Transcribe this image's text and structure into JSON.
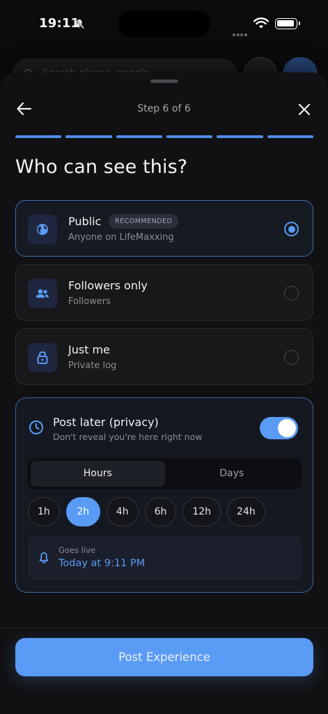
{
  "status_bar": {
    "time": "19:11"
  },
  "background_page": {
    "search_placeholder": "Search places, people…"
  },
  "header": {
    "step_label": "Step 6 of 6"
  },
  "progress": {
    "total_steps": 6,
    "current_step": 6
  },
  "title": "Who can see this?",
  "options": [
    {
      "label": "Public",
      "badge": "RECOMMENDED",
      "sub": "Anyone on LifeMaxxing",
      "icon": "globe-icon",
      "selected": true
    },
    {
      "label": "Followers only",
      "sub": "Followers",
      "icon": "people-icon",
      "selected": false
    },
    {
      "label": "Just me",
      "sub": "Private log",
      "icon": "lock-icon",
      "selected": false
    }
  ],
  "post_later": {
    "title": "Post later (privacy)",
    "subtitle": "Don't reveal you're here right now",
    "enabled": true,
    "tabs": [
      "Hours",
      "Days"
    ],
    "active_tab": "Hours",
    "chips": [
      "1h",
      "2h",
      "4h",
      "6h",
      "12h",
      "24h"
    ],
    "selected_chip": "2h",
    "goes_live_label": "Goes live",
    "goes_live_value": "Today at 9:11 PM"
  },
  "cta": {
    "label": "Post Experience"
  },
  "colors": {
    "accent": "#5a9bf5",
    "background": "#111113",
    "card": "#18181b"
  }
}
